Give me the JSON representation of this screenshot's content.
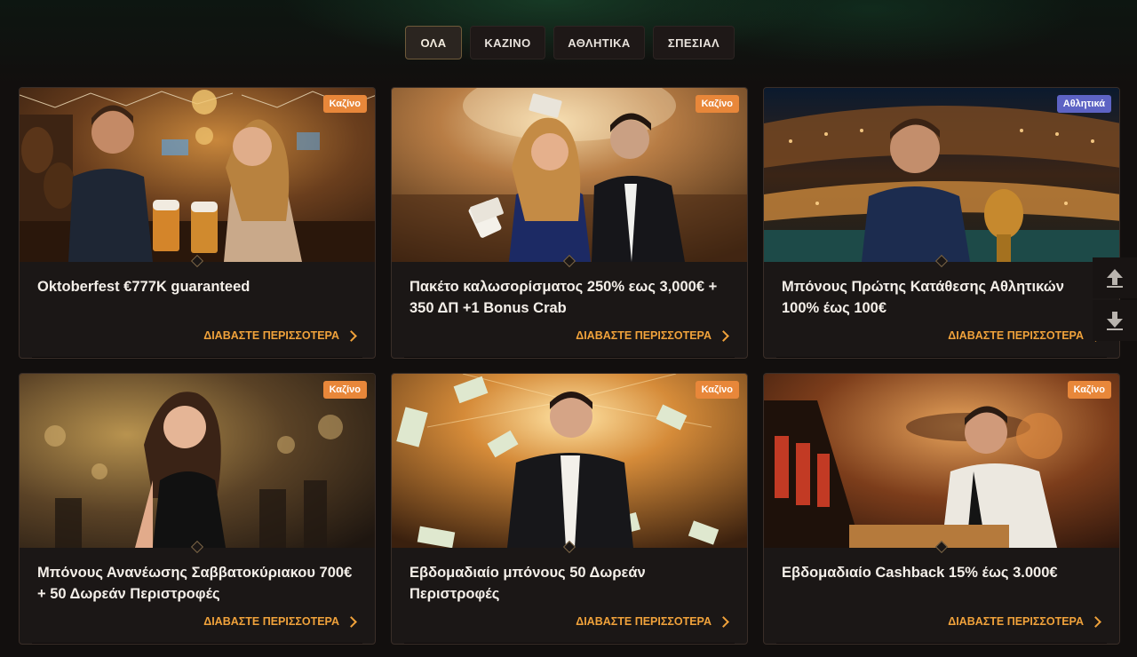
{
  "tabs": {
    "all": "ΟΛΑ",
    "casino": "ΚΑΖΙΝΟ",
    "sports": "ΑΘΛΗΤΙΚΑ",
    "special": "ΣΠΕΣΙΑΛ"
  },
  "cards": [
    {
      "badge": "Καζίνο",
      "title": "Oktoberfest €777K guaranteed",
      "link": "ΔΙΑΒΑΣΤΕ ΠΕΡΙΣΣΟΤΕΡΑ"
    },
    {
      "badge": "Καζίνο",
      "title": "Πακέτο καλωσορίσματος 250% εως 3,000€ + 350 ΔΠ +1 Bonus Crab",
      "link": "ΔΙΑΒΑΣΤΕ ΠΕΡΙΣΣΟΤΕΡΑ"
    },
    {
      "badge": "Αθλητικά",
      "title": "Μπόνους Πρώτης Κατάθεσης Αθλητικών 100% έως 100€",
      "link": "ΔΙΑΒΑΣΤΕ ΠΕΡΙΣΣΟΤΕΡΑ"
    },
    {
      "badge": "Καζίνο",
      "title": "Μπόνους Ανανέωσης Σαββατοκύριακου 700€ + 50 Δωρεάν Περιστροφές",
      "link": "ΔΙΑΒΑΣΤΕ ΠΕΡΙΣΣΟΤΕΡΑ"
    },
    {
      "badge": "Καζίνο",
      "title": "Εβδομαδιαίο μπόνους 50 Δωρεάν Περιστροφές",
      "link": "ΔΙΑΒΑΣΤΕ ΠΕΡΙΣΣΟΤΕΡΑ"
    },
    {
      "badge": "Καζίνο",
      "title": "Εβδομαδιαίο Cashback 15% έως 3.000€",
      "link": "ΔΙΑΒΑΣΤΕ ΠΕΡΙΣΣΟΤΕΡΑ"
    }
  ],
  "icons": {
    "scroll_up": "arrow-up-icon",
    "scroll_down": "arrow-down-icon",
    "link_arrow": "chevron-right-icon"
  },
  "colors": {
    "accent": "#f0a23b",
    "casino_badge": "#e8873a",
    "sports_badge": "#5d63c4",
    "background": "#120f0e",
    "card": "#1b1716"
  }
}
